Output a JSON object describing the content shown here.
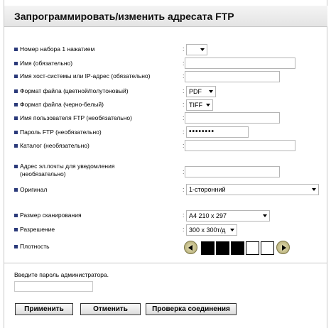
{
  "title": "Запрограммировать/изменить адресата FTP",
  "rows": [
    {
      "label": "Номер набора 1 нажатием",
      "value": "",
      "kind": "select"
    },
    {
      "label": "Имя (обязательно)",
      "value": "",
      "kind": "text"
    },
    {
      "label": "Имя хост-системы или IP-адрес (обязательно)",
      "value": "",
      "kind": "text"
    },
    {
      "label": "Формат файла (цветной/полутоновый)",
      "value": "PDF",
      "kind": "select"
    },
    {
      "label": "Формат файла (черно-белый)",
      "value": "TIFF",
      "kind": "select"
    },
    {
      "label": "Имя пользователя FTP (необязательно)",
      "value": "",
      "kind": "text"
    },
    {
      "label": "Пароль FTP (необязательно)",
      "value": "••••••••",
      "kind": "password"
    },
    {
      "label": "Каталог (необязательно)",
      "value": "",
      "kind": "text"
    },
    {
      "label": "Адрес эл.почты для уведомления (необязательно)",
      "value": "",
      "kind": "text"
    },
    {
      "label": "Оригинал",
      "value": "1-сторонний",
      "kind": "select"
    },
    {
      "label": "Размер сканирования",
      "value": "A4 210 x 297",
      "kind": "select"
    },
    {
      "label": "Разрешение",
      "value": "300 x 300т/д",
      "kind": "select"
    },
    {
      "label": "Плотность",
      "kind": "density"
    }
  ],
  "separator": ":",
  "density": {
    "level": 3,
    "steps": 5
  },
  "admin": {
    "prompt": "Введите пароль администратора.",
    "value": ""
  },
  "buttons": {
    "apply": "Применить",
    "cancel": "Отменить",
    "check": "Проверка соединения"
  },
  "colors": {
    "bullet": "#2b3a7a",
    "filled_cell": "#000000",
    "header": "#e8e8e8"
  }
}
